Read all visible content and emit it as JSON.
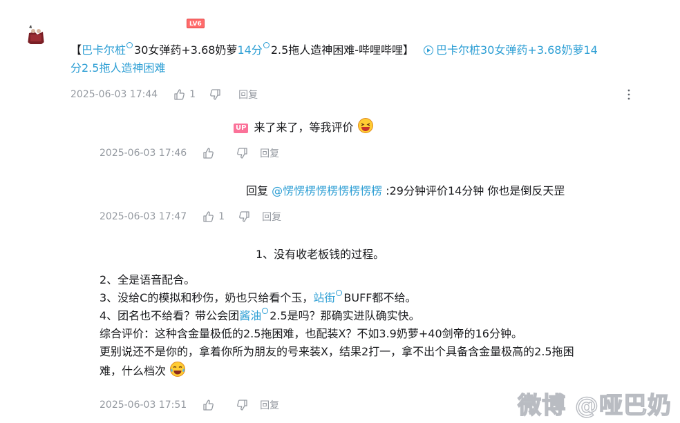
{
  "main_comment": {
    "level": "LV6",
    "text": {
      "open": "【",
      "link1": "巴卡尔桩",
      "part2": "30女弹药+3.68奶萝",
      "link2": "14分",
      "part3": "2.5拖人造神困难-哔哩哔哩】",
      "video_link_line1": "巴卡尔桩30女弹药+3.68奶萝14",
      "video_link_line2": "分2.5拖人造神困难"
    },
    "time": "2025-06-03 17:44",
    "likes": "1",
    "reply_label": "回复"
  },
  "replies": [
    {
      "badge": "UP",
      "text": "来了来了，等我评价",
      "time": "2025-06-03 17:46",
      "likes": "",
      "reply_label": "回复"
    },
    {
      "prefix": "回复 ",
      "mention": "@愣愣楞愣楞愣楞愣楞",
      "text": " :29分钟评价14分钟 你也是倒反天罡",
      "time": "2025-06-03 17:47",
      "likes": "1",
      "reply_label": "回复"
    },
    {
      "line1": "1、没有收老板钱的过程。",
      "line2": "2、全是语音配合。",
      "line3_a": "3、没给C的模拟和秒伤，奶也只给看个玉，",
      "line3_link": "站街",
      "line3_b": "BUFF都不给。",
      "line4_a": "4、团名也不给看？带公会团",
      "line4_link": "酱油",
      "line4_b": "2.5是吗？那确实进队确实快。",
      "line5": "综合评价：这种含金量极低的2.5拖困难，也配装X？不如3.9奶萝+40剑帝的16分钟。",
      "line6": "更别说还不是你的，拿着你所为朋友的号来装X，结果2打一，拿不出个具备含金量极高的2.5拖困",
      "line7": "难，什么档次",
      "time": "2025-06-03 17:51",
      "likes": "",
      "reply_label": "回复"
    }
  ],
  "watermark": "微博 @哑巴奶",
  "colors": {
    "link": "#2c9ed4",
    "meta": "#9499a0",
    "up_badge": "#fb7299",
    "level": "#ff6b6b"
  }
}
